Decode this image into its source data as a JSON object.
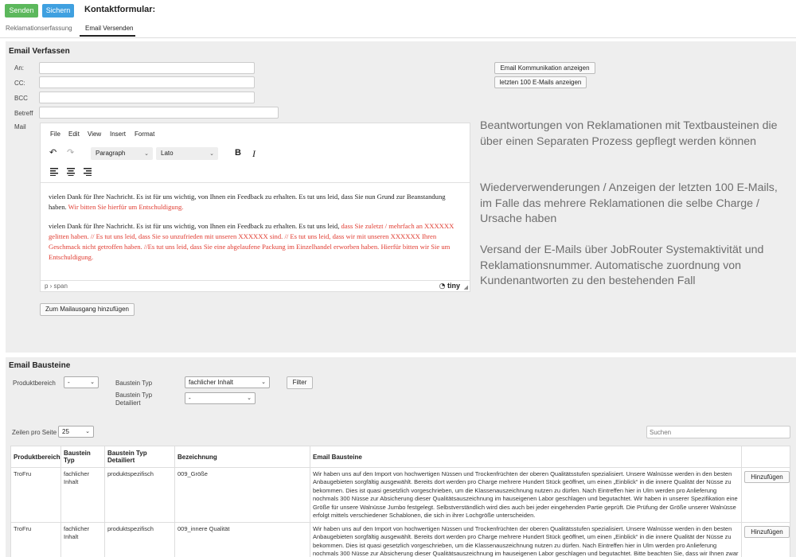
{
  "topbar": {
    "send_label": "Senden",
    "save_label": "Sichern",
    "title": "Kontaktformular:"
  },
  "tabs": [
    {
      "label": "Reklamationserfassung",
      "active": false
    },
    {
      "label": "Email Versenden",
      "active": true
    }
  ],
  "compose": {
    "title": "Email Verfassen",
    "to_label": "An:",
    "cc_label": "CC:",
    "bcc_label": "BCC",
    "subject_label": "Betreff",
    "mail_label": "Mail",
    "to_value": "",
    "cc_value": "",
    "bcc_value": "",
    "subject_value": "",
    "btn_comm": "Email Kommunikation anzeigen",
    "btn_last100": "letzten 100 E-Mails anzeigen",
    "btn_add_outbox": "Zum Mailausgang hinzufügen"
  },
  "editor": {
    "menu": [
      "File",
      "Edit",
      "View",
      "Insert",
      "Format"
    ],
    "block_format": "Paragraph",
    "font": "Lato",
    "icons": {
      "undo": "undo-icon",
      "redo": "redo-icon",
      "bold": "bold-icon",
      "italic": "italic-icon",
      "align_left": "align-left-icon",
      "align_center": "align-center-icon",
      "align_right": "align-right-icon"
    },
    "para1_black": "vielen Dank für Ihre Nachricht. Es ist für uns wichtig, von Ihnen ein Feedback zu erhalten. Es tut uns leid, dass Sie nun Grund zur Beanstandung haben.",
    "para1_red": " Wir bitten Sie hierfür um Entschuldigung.",
    "para2_black": "vielen Dank für Ihre Nachricht. Es ist für uns wichtig, von Ihnen ein Feedback zu erhalten. Es tut uns leid,",
    "para2_red": " dass Sie zuletzt / mehrfach an XXXXXX gelitten haben. // Es tut uns leid, dass Sie so unzufrieden mit unseren XXXXXX sind. // Es tut uns leid, dass wir mit unseren XXXXXX Ihren Geschmack nicht getroffen haben. //Es tut uns leid, dass Sie eine abgelaufene Packung im Einzelhandel erworben haben. Hierfür bitten wir Sie um Entschuldigung.",
    "status_path": "p › span",
    "brand": "tiny"
  },
  "annotations": [
    "Beantwortungen von Reklamationen mit Textbausteinen die über einen Separaten Prozess gepflegt werden können",
    "Wiederverwenderungen / Anzeigen der letzten 100 E-Mails, im Falle das mehrere Reklamationen die selbe Charge / Ursache haben",
    "Versand der E-Mails über JobRouter Systemaktivität und Reklamationsnummer. Automatische zuordnung von Kundenantworten zu den bestehenden Fall"
  ],
  "bausteine": {
    "title": "Email Bausteine",
    "produktbereich_label": "Produktbereich",
    "produktbereich_value": "-",
    "typ_label": "Baustein Typ",
    "typ_value": "fachlicher Inhalt",
    "typ_detail_label": "Baustein Typ Detailiert",
    "typ_detail_value": "-",
    "filter_label": "Filter",
    "rows_label": "Zeilen pro Seite",
    "rows_value": "25",
    "search_placeholder": "Suchen",
    "columns": [
      "Produktbereich",
      "Baustein Typ",
      "Baustein Typ Detailiert",
      "Bezeichnung",
      "Email Bausteine",
      ""
    ],
    "add_label": "Hinzufügen",
    "rows": [
      {
        "produktbereich": "TroFru",
        "typ": "fachlicher Inhalt",
        "typ_detail": "produktspezifisch",
        "bezeichnung": "009_Größe",
        "text": "Wir haben uns auf den Import von hochwertigen Nüssen und Trockenfrüchten der oberen Qualitätsstufen spezialisiert. Unsere Walnüsse werden in den besten Anbaugebieten sorgfältig ausgewählt. Bereits dort werden pro Charge mehrere Hundert Stück geöffnet, um einen „Einblick“ in die innere Qualität der Nüsse zu bekommen. Dies ist quasi gesetzlich vorgeschrieben, um die Klassenauszeichnung nutzen zu dürfen. Nach Eintreffen hier in Ulm werden pro Anlieferung nochmals 300 Nüsse zur Absicherung dieser Qualitätsauszeichnung im hauseigenen Labor geschlagen und begutachtet. Wir haben in unserer Spezifikation eine Größe für unsere Walnüsse Jumbo festgelegt. Selbstverständlich wird dies auch bei jeder eingehenden Partie geprüft. Die Prüfung der Größe unserer Walnüsse erfolgt mittels verschiedener Schablonen, die sich in ihrer Lochgröße unterscheiden."
      },
      {
        "produktbereich": "TroFru",
        "typ": "fachlicher Inhalt",
        "typ_detail": "produktspezifisch",
        "bezeichnung": "009_innere Qualität",
        "text": "Wir haben uns auf den Import von hochwertigen Nüssen und Trockenfrüchten der oberen Qualitätsstufen spezialisiert. Unsere Walnüsse werden in den besten Anbaugebieten sorgfältig ausgewählt. Bereits dort werden pro Charge mehrere Hundert Stück geöffnet, um einen „Einblick“ in die innere Qualität der Nüsse zu bekommen. Dies ist quasi gesetzlich vorgeschrieben, um die Klassenauszeichnung nutzen zu dürfen. Nach Eintreffen hier in Ulm werden pro Anlieferung nochmals 300 Nüsse zur Absicherung dieser Qualitätsauszeichnung im hauseigenen Labor geschlagen und begutachtet. Bitte beachten Sie, dass wir Ihnen zwar wertvolle, aber unbehandelte Lebensmittel anbieten. Dabei ist ein gewisser Anteil an mangelhaften Nüssen"
      }
    ]
  }
}
